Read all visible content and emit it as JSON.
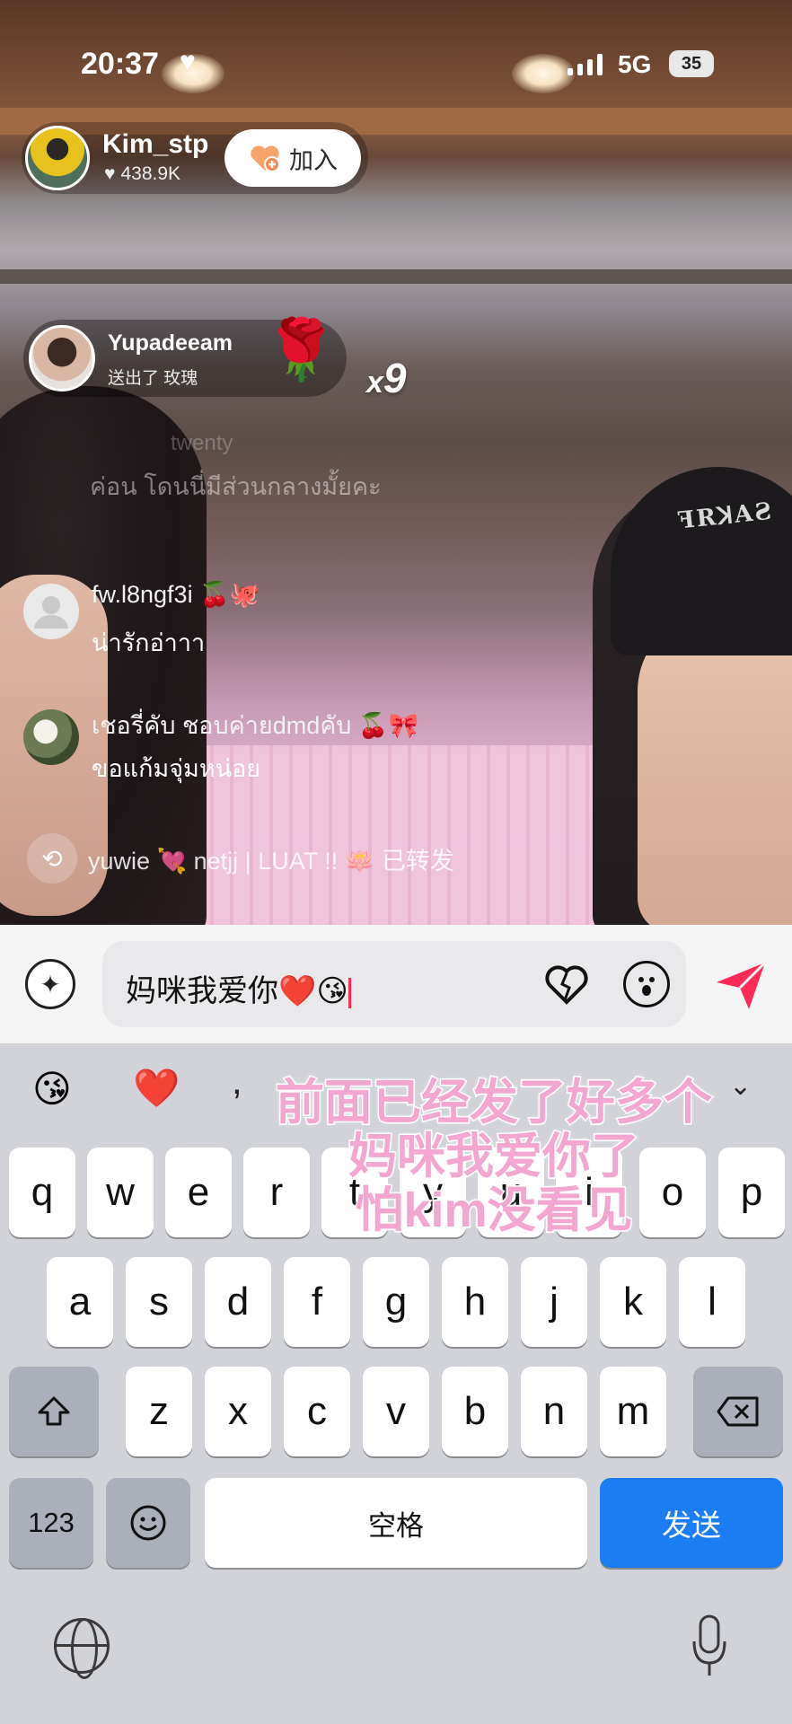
{
  "status_bar": {
    "time": "20:37",
    "heart": "♥",
    "network": "5G",
    "battery": "35"
  },
  "host": {
    "name": "Kim_stp",
    "likes": "438.9K",
    "join_label": "加入"
  },
  "gift": {
    "sender": "Yupadeeam",
    "action": "送出了 玫瑰",
    "gift_icon": "rose",
    "count_prefix": "x",
    "count": "9"
  },
  "comments_faded": {
    "name": "twenty",
    "text": "ค่อน โดนนี่มีส่วนกลางมั้ยคะ"
  },
  "comments": [
    {
      "name": "fw.l8ngf3i 🍒🐙",
      "text": "น่ารักอ่าาา"
    },
    {
      "name": "เชอรี่คับ ชอบค่ายdmdคับ 🍒🎀",
      "text": "ขอแก้มจุ่มหน่อย"
    }
  ],
  "repost": {
    "text": "yuwie 💘 netjj | LUAT !! 🪷 已转发"
  },
  "input": {
    "value": "妈咪我爱你❤️😘"
  },
  "keyboard": {
    "suggestions": [
      "😘",
      "❤️"
    ],
    "comma": ",",
    "row1": [
      "q",
      "w",
      "e",
      "r",
      "t",
      "y",
      "u",
      "i",
      "o",
      "p"
    ],
    "row2": [
      "a",
      "s",
      "d",
      "f",
      "g",
      "h",
      "j",
      "k",
      "l"
    ],
    "row3": [
      "z",
      "x",
      "c",
      "v",
      "b",
      "n",
      "m"
    ],
    "numbers_label": "123",
    "space_label": "空格",
    "send_label": "发送"
  },
  "caption": {
    "line1": "前面已经发了好多个",
    "line2": "妈咪我爱你了",
    "line3": "怕kim没看见"
  },
  "colors": {
    "accent_send": "#ff2a55",
    "keyboard_send": "#1c7cf2",
    "caption_pink": "#f3a6cf"
  }
}
